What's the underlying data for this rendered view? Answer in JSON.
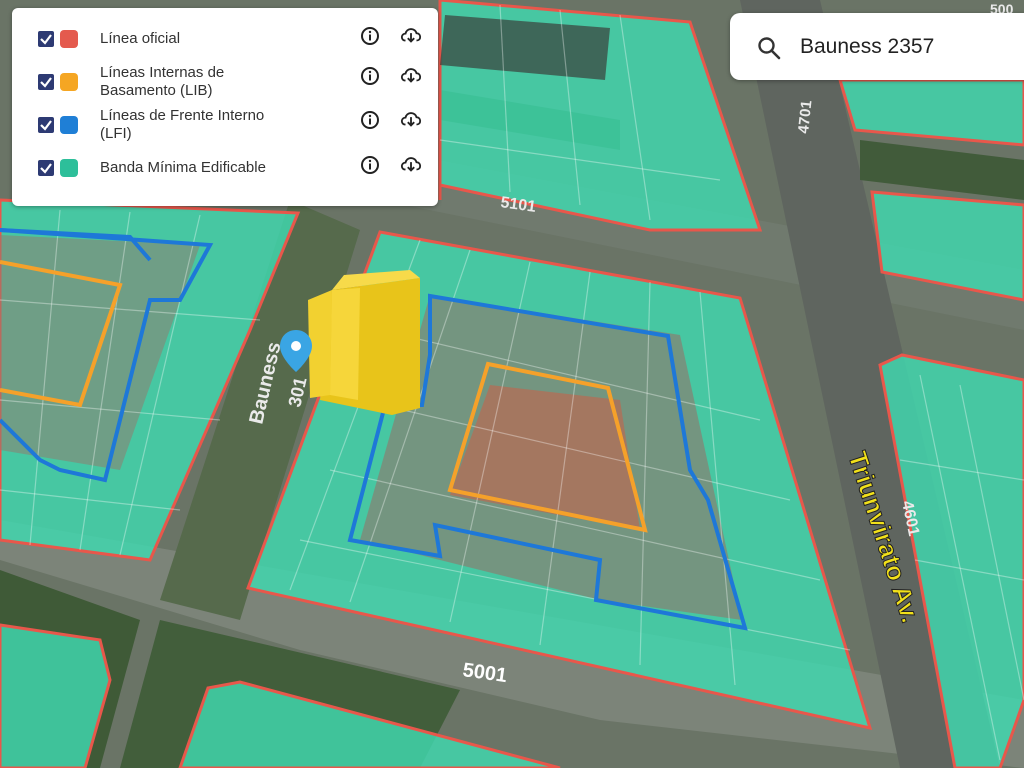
{
  "legend": {
    "items": [
      {
        "label": "Línea oficial",
        "color": "#e45a4e"
      },
      {
        "label": "Líneas Internas de\nBasamento (LIB)",
        "color": "#f5a623"
      },
      {
        "label": "Líneas de Frente Interno\n(LFI)",
        "color": "#1f7fd6"
      },
      {
        "label": "Banda Mínima Edificable",
        "color": "#2dbf9a"
      }
    ],
    "info_icon": "info-icon",
    "download_icon": "cloud-download-icon"
  },
  "search": {
    "value": "Bauness 2357",
    "icon": "search-icon"
  },
  "map_labels": {
    "street_bauness": "Bauness",
    "num_301": "301",
    "num_5101": "5101",
    "num_4701": "4701",
    "num_5001": "5001",
    "num_4601": "4601",
    "avenue": "Triunvirato Av.",
    "corner_tr": "500"
  },
  "colors": {
    "block_fill": "#3fd9b0",
    "official_line": "#e8574b",
    "lib_line": "#f5a12a",
    "lfi_line": "#1e78d8",
    "building": "#f2cd1f"
  }
}
